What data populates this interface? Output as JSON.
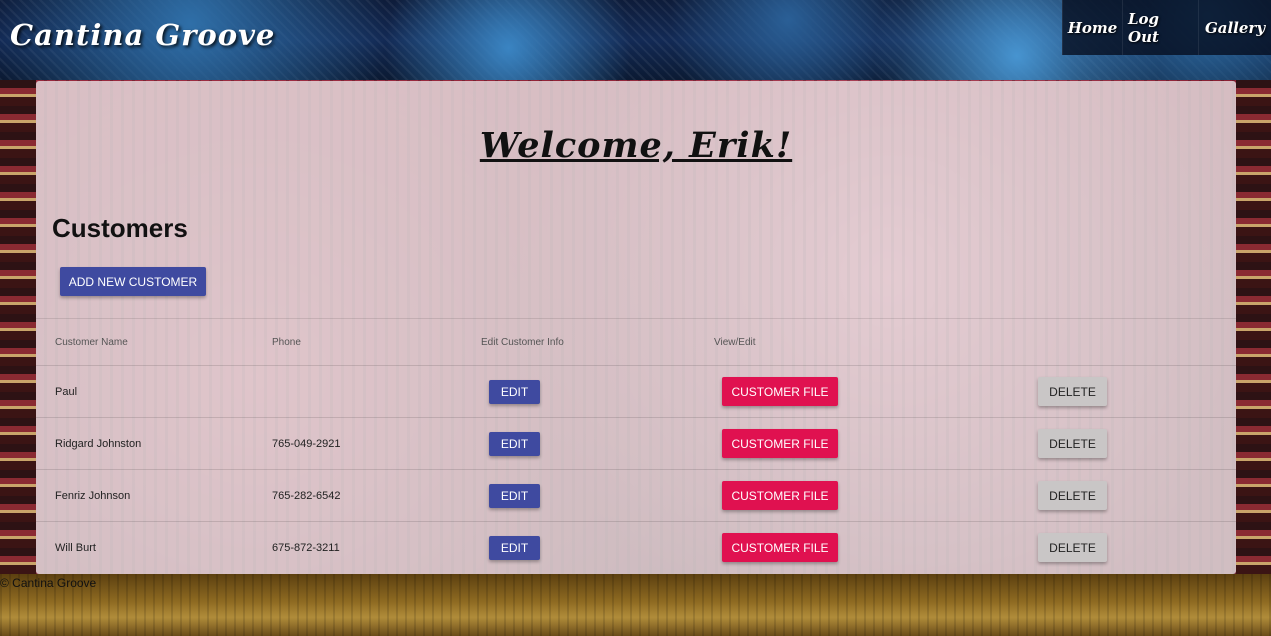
{
  "header": {
    "brand": "Cantina Groove",
    "nav": [
      {
        "label": "Home"
      },
      {
        "label": "Log Out"
      },
      {
        "label": "Gallery"
      }
    ]
  },
  "main": {
    "welcome": "Welcome, Erik!",
    "section_title": "Customers",
    "add_button": "ADD NEW CUSTOMER",
    "table": {
      "headers": [
        "Customer Name",
        "Phone",
        "Edit Customer Info",
        "View/Edit",
        ""
      ],
      "rows": [
        {
          "name": "Paul",
          "phone": "",
          "edit": "EDIT",
          "file": "CUSTOMER FILE",
          "delete": "DELETE"
        },
        {
          "name": "Ridgard Johnston",
          "phone": "765-049-2921",
          "edit": "EDIT",
          "file": "CUSTOMER FILE",
          "delete": "DELETE"
        },
        {
          "name": "Fenriz Johnson",
          "phone": "765-282-6542",
          "edit": "EDIT",
          "file": "CUSTOMER FILE",
          "delete": "DELETE"
        },
        {
          "name": "Will Burt",
          "phone": "675-872-3211",
          "edit": "EDIT",
          "file": "CUSTOMER FILE",
          "delete": "DELETE"
        }
      ]
    }
  },
  "footer": {
    "copyright": "© Cantina Groove"
  },
  "colors": {
    "primary_button": "#3f4aa0",
    "accent_button": "#e01150",
    "delete_button": "#c9c6c6"
  }
}
